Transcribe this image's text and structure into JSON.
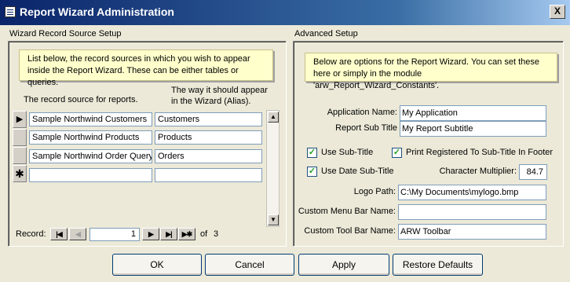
{
  "window": {
    "title": "Report Wizard Administration",
    "close_symbol": "X"
  },
  "left": {
    "section_title": "Wizard Record Source Setup",
    "note": "List below, the record sources in which you wish to appear inside the Report Wizard.  These can be either tables or queries.",
    "col_source_header": "The record source for reports.",
    "col_alias_header": "The way it should appear in the Wizard (Alias).",
    "rows": [
      {
        "marker": "▶",
        "source": "Sample Northwind Customers",
        "alias": "Customers"
      },
      {
        "marker": "",
        "source": "Sample Northwind Products",
        "alias": "Products"
      },
      {
        "marker": "",
        "source": "Sample Northwind Order Query",
        "alias": "Orders"
      },
      {
        "marker": "✱",
        "source": "",
        "alias": ""
      }
    ],
    "nav": {
      "label": "Record:",
      "current": "1",
      "of_label": "of",
      "total": "3"
    }
  },
  "right": {
    "section_title": "Advanced Setup",
    "note": "Below are options for the Report Wizard.  You can set these here or simply in the module 'arw_Report_Wizard_Constants'.",
    "app_name_label": "Application Name:",
    "app_name_value": "My Application",
    "subtitle_label": "Report Sub Title",
    "subtitle_value": "My Report Subtitle",
    "use_subtitle_label": "Use Sub-Title",
    "use_subtitle_checked": true,
    "print_registered_label": "Print Registered To Sub-Title In Footer",
    "print_registered_checked": true,
    "use_date_label": "Use Date Sub-Title",
    "use_date_checked": true,
    "char_mult_label": "Character Multiplier:",
    "char_mult_value": "84.7",
    "logo_label": "Logo Path:",
    "logo_value": "C:\\My Documents\\mylogo.bmp",
    "menu_label": "Custom Menu Bar Name:",
    "menu_value": "",
    "toolbar_label": "Custom Tool Bar Name:",
    "toolbar_value": "ARW Toolbar",
    "check_mark": "✓"
  },
  "buttons": {
    "ok": "OK",
    "cancel": "Cancel",
    "apply": "Apply",
    "restore": "Restore Defaults"
  },
  "colors": {
    "title_bar": "#0a246a",
    "note_bg": "#ffffcc",
    "window_bg": "#ece9d8"
  }
}
